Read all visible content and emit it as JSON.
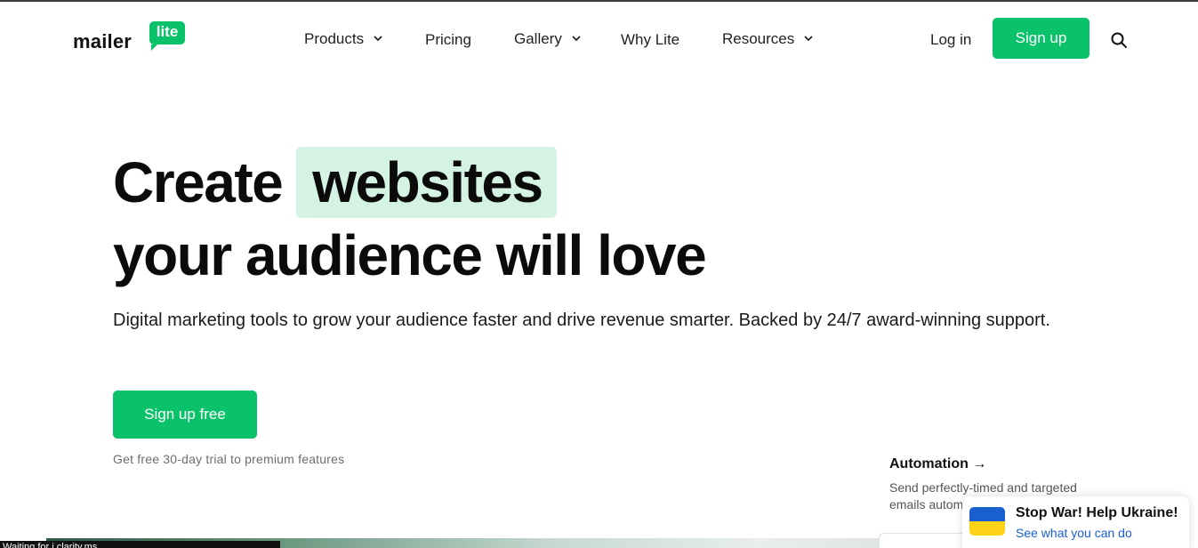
{
  "header": {
    "logo_text": "mailer",
    "logo_badge": "lite",
    "nav": [
      {
        "label": "Products",
        "has_dropdown": true
      },
      {
        "label": "Pricing",
        "has_dropdown": false
      },
      {
        "label": "Gallery",
        "has_dropdown": true
      },
      {
        "label": "Why Lite",
        "has_dropdown": false
      },
      {
        "label": "Resources",
        "has_dropdown": true
      }
    ],
    "login_label": "Log in",
    "signup_label": "Sign up",
    "search_icon": "search-icon"
  },
  "hero": {
    "title_prefix": "Create",
    "title_highlight": "websites",
    "title_line2": "your audience will love",
    "description": "Digital marketing tools to grow your audience faster and drive revenue smarter. Backed by 24/7 award-winning support.",
    "cta_label": "Sign up free",
    "trial_note": "Get free 30-day trial to premium features"
  },
  "feature": {
    "title": "Automation",
    "arrow": "→",
    "description": "Send perfectly-timed and targeted emails autom"
  },
  "ukraine_banner": {
    "title": "Stop War! Help Ukraine!",
    "link": "See what you can do"
  },
  "status_bar": {
    "text": "Waiting for j.clarity.ms..."
  },
  "colors": {
    "brand_green": "#09c269",
    "highlight_green": "#d4f3e3",
    "link_blue": "#1a5fd0",
    "flag_blue": "#1a5fd0",
    "flag_yellow": "#ffd21a"
  }
}
